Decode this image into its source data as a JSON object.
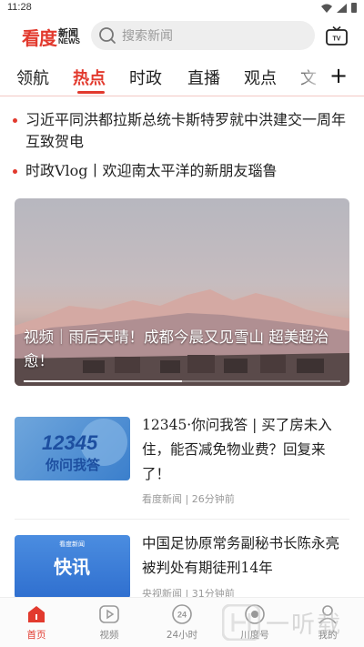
{
  "status_bar": {
    "time": "11:28"
  },
  "header": {
    "logo_main": "看度",
    "logo_sub_cn": "新闻",
    "logo_sub_en": "NEWS",
    "search_placeholder": "搜索新闻"
  },
  "tabs": [
    {
      "label": "领航",
      "active": false
    },
    {
      "label": "热点",
      "active": true
    },
    {
      "label": "时政",
      "active": false
    },
    {
      "label": "直播",
      "active": false
    },
    {
      "label": "观点",
      "active": false
    },
    {
      "label": "文",
      "active": false
    }
  ],
  "headlines": [
    "习近平同洪都拉斯总统卡斯特罗就中洪建交一周年互致贺电",
    "时政Vlog丨欢迎南太平洋的新朋友瑙鲁"
  ],
  "hero": {
    "title": "视频｜雨后天晴！成都今晨又见雪山 超美超治愈！",
    "progress": 0.5
  },
  "news": [
    {
      "title": "12345·你问我答 | 买了房未入住，能否减免物业费？回复来了！",
      "source": "看度新闻",
      "time": "26分钟前",
      "thumb_text_line1": "12345",
      "thumb_text_line2": "你问我答"
    },
    {
      "title": "中国足协原常务副秘书长陈永亮被判处有期徒刑14年",
      "source": "央视新闻",
      "time": "31分钟前",
      "thumb_text_line1": "看度新闻",
      "thumb_text_line2": "快讯"
    }
  ],
  "bottom_nav": [
    {
      "label": "首页",
      "icon": "home-icon",
      "active": true
    },
    {
      "label": "视频",
      "icon": "video-icon",
      "active": false
    },
    {
      "label": "24小时",
      "icon": "clock-24-icon",
      "active": false
    },
    {
      "label": "川度号",
      "icon": "record-icon",
      "active": false
    },
    {
      "label": "我的",
      "icon": "user-icon",
      "active": false
    }
  ],
  "watermark": {
    "text": "一听载"
  },
  "colors": {
    "accent": "#e23a2e",
    "muted": "#999999"
  }
}
